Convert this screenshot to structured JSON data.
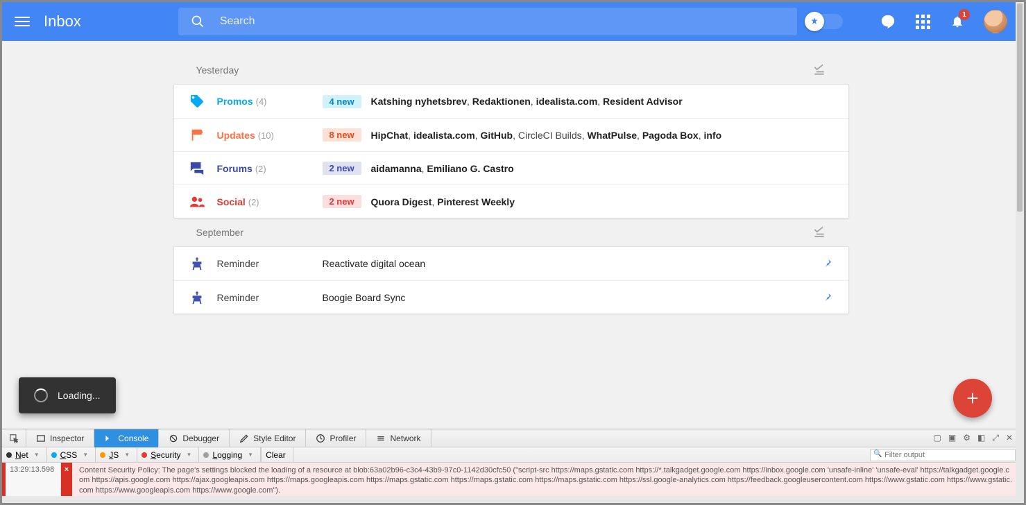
{
  "header": {
    "title": "Inbox",
    "search_placeholder": "Search",
    "notification_count": "1"
  },
  "sections": [
    {
      "title": "Yesterday",
      "rows": [
        {
          "kind": "cluster",
          "label": "Promos",
          "count": "(4)",
          "badge": "4 new",
          "color": "promos",
          "senders": [
            {
              "t": "Katshing nyhetsbrev",
              "b": true
            },
            {
              "t": ", "
            },
            {
              "t": "Redaktionen",
              "b": true
            },
            {
              "t": ", "
            },
            {
              "t": "idealista.com",
              "b": true
            },
            {
              "t": ", "
            },
            {
              "t": "Resident Advisor",
              "b": true
            }
          ]
        },
        {
          "kind": "cluster",
          "label": "Updates",
          "count": "(10)",
          "badge": "8 new",
          "color": "updates",
          "senders": [
            {
              "t": "HipChat",
              "b": true
            },
            {
              "t": ", "
            },
            {
              "t": "idealista.com",
              "b": true
            },
            {
              "t": ", "
            },
            {
              "t": "GitHub",
              "b": true
            },
            {
              "t": ", CircleCI Builds, "
            },
            {
              "t": "WhatPulse",
              "b": true
            },
            {
              "t": ", "
            },
            {
              "t": "Pagoda Box",
              "b": true
            },
            {
              "t": ", "
            },
            {
              "t": "info",
              "b": true
            }
          ]
        },
        {
          "kind": "cluster",
          "label": "Forums",
          "count": "(2)",
          "badge": "2 new",
          "color": "forums",
          "senders": [
            {
              "t": "aidamanna",
              "b": true
            },
            {
              "t": ", "
            },
            {
              "t": "Emiliano G. Castro",
              "b": true
            }
          ]
        },
        {
          "kind": "cluster",
          "label": "Social",
          "count": "(2)",
          "badge": "2 new",
          "color": "social",
          "senders": [
            {
              "t": "Quora Digest",
              "b": true
            },
            {
              "t": ", "
            },
            {
              "t": "Pinterest Weekly",
              "b": true
            }
          ]
        }
      ]
    },
    {
      "title": "September",
      "rows": [
        {
          "kind": "reminder",
          "label": "Reminder",
          "text": "Reactivate digital ocean"
        },
        {
          "kind": "reminder",
          "label": "Reminder",
          "text": "Boogie Board Sync"
        }
      ]
    }
  ],
  "toast": {
    "text": "Loading..."
  },
  "devtools": {
    "tabs": [
      "Inspector",
      "Console",
      "Debugger",
      "Style Editor",
      "Profiler",
      "Network"
    ],
    "active_tab": "Console",
    "filters": [
      {
        "label": "Net",
        "color": "#333",
        "underline": true
      },
      {
        "label": "CSS",
        "color": "#03a9f4",
        "underline": true
      },
      {
        "label": "JS",
        "color": "#ff9800",
        "underline": true
      },
      {
        "label": "Security",
        "color": "#e53935",
        "underline": true
      },
      {
        "label": "Logging",
        "color": "#9e9e9e",
        "underline": true
      }
    ],
    "clear_label": "Clear",
    "filter_placeholder": "Filter output",
    "log": {
      "time": "13:29:13.598",
      "msg": "Content Security Policy: The page's settings blocked the loading of a resource at blob:63a02b96-c3c4-43b9-97c0-1142d30cfc50 (\"script-src https://maps.gstatic.com https://*.talkgadget.google.com https://inbox.google.com 'unsafe-inline' 'unsafe-eval' https://talkgadget.google.com https://apis.google.com https://ajax.googleapis.com https://maps.googleapis.com https://maps.gstatic.com https://maps.gstatic.com https://maps.gstatic.com https://ssl.google-analytics.com https://feedback.googleusercontent.com https://www.gstatic.com https://www.gstatic.com https://www.googleapis.com https://www.google.com\")."
    }
  }
}
